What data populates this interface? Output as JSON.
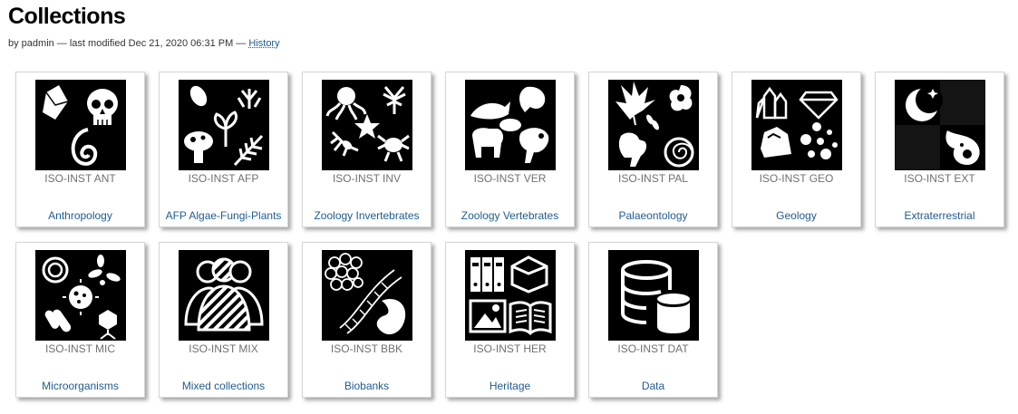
{
  "page": {
    "title": "Collections",
    "byline_prefix": "by padmin — last modified Dec 21, 2020 06:31 PM —",
    "history_link": "History"
  },
  "collections": [
    {
      "code": "ISO-INST ANT",
      "name": "Anthropology",
      "icon": "anthropology-icon"
    },
    {
      "code": "ISO-INST AFP",
      "name": "AFP Algae-Fungi-Plants",
      "icon": "algae-fungi-plants-icon"
    },
    {
      "code": "ISO-INST INV",
      "name": "Zoology Invertebrates",
      "icon": "invertebrates-icon"
    },
    {
      "code": "ISO-INST VER",
      "name": "Zoology Vertebrates",
      "icon": "vertebrates-icon"
    },
    {
      "code": "ISO-INST PAL",
      "name": "Palaeontology",
      "icon": "palaeontology-icon"
    },
    {
      "code": "ISO-INST GEO",
      "name": "Geology",
      "icon": "geology-icon"
    },
    {
      "code": "ISO-INST EXT",
      "name": "Extraterrestrial",
      "icon": "extraterrestrial-icon"
    },
    {
      "code": "ISO-INST MIC",
      "name": "Microorganisms",
      "icon": "microorganisms-icon"
    },
    {
      "code": "ISO-INST MIX",
      "name": "Mixed collections",
      "icon": "mixed-collections-icon"
    },
    {
      "code": "ISO-INST BBK",
      "name": "Biobanks",
      "icon": "biobanks-icon"
    },
    {
      "code": "ISO-INST HER",
      "name": "Heritage",
      "icon": "heritage-icon"
    },
    {
      "code": "ISO-INST DAT",
      "name": "Data",
      "icon": "data-icon"
    }
  ]
}
